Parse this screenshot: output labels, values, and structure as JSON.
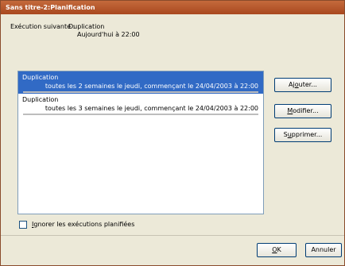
{
  "window": {
    "title": "Sans titre-2:Planification"
  },
  "next_execution": {
    "label": "Exécution suivante :",
    "value": "Duplication",
    "time": "Aujourd'hui à 22:00"
  },
  "schedules": [
    {
      "title": "Duplication",
      "description": "toutes les 2 semaines le jeudi, commençant le 24/04/2003 à 22:00",
      "selected": true
    },
    {
      "title": "Duplication",
      "description": "toutes les 3 semaines le jeudi, commençant le 24/04/2003 à 22:00",
      "selected": false
    }
  ],
  "buttons": {
    "add_prefix": "Aj",
    "add_key": "o",
    "add_suffix": "uter...",
    "modify_key": "M",
    "modify_suffix": "odifier...",
    "delete_prefix": "S",
    "delete_key": "u",
    "delete_suffix": "pprimer...",
    "ok_key": "O",
    "ok_suffix": "K",
    "cancel": "Annuler"
  },
  "ignore_checkbox": {
    "key": "I",
    "label_suffix": "gnorer les exécutions planifiées",
    "checked": false
  },
  "colors": {
    "titlebar": "#a9481f",
    "selection": "#316ac5",
    "dialog_bg": "#ece9d8"
  }
}
